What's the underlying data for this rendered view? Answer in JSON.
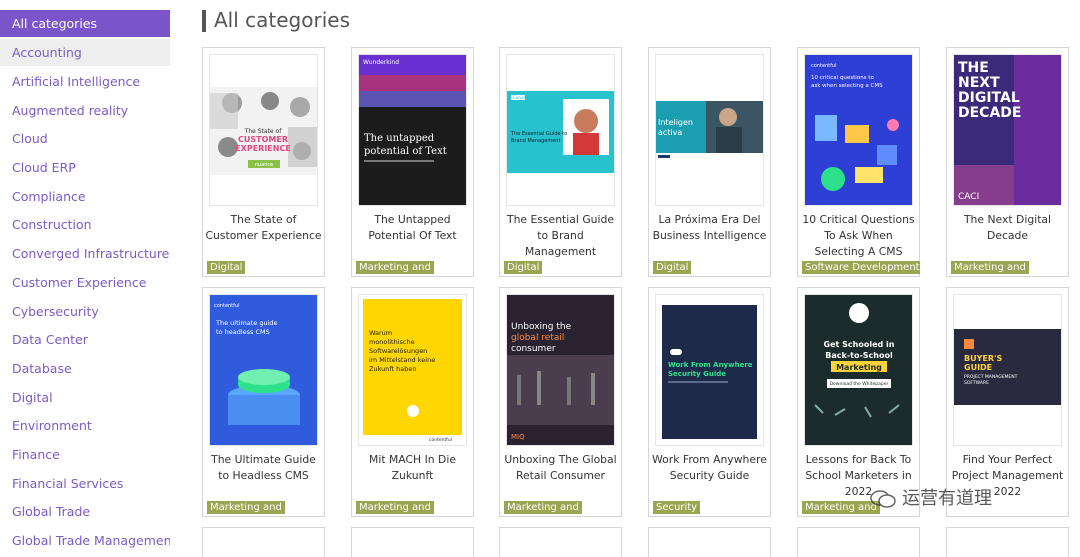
{
  "sidebar": {
    "items": [
      {
        "label": "All categories",
        "state": "active"
      },
      {
        "label": "Accounting",
        "state": "hover"
      },
      {
        "label": "Artificial Intelligence"
      },
      {
        "label": "Augmented reality"
      },
      {
        "label": "Cloud"
      },
      {
        "label": "Cloud ERP"
      },
      {
        "label": "Compliance"
      },
      {
        "label": "Construction"
      },
      {
        "label": "Converged Infrastructure"
      },
      {
        "label": "Customer Experience"
      },
      {
        "label": "Cybersecurity"
      },
      {
        "label": "Data Center"
      },
      {
        "label": "Database"
      },
      {
        "label": "Digital"
      },
      {
        "label": "Environment"
      },
      {
        "label": "Finance"
      },
      {
        "label": "Financial Services"
      },
      {
        "label": "Global Trade"
      },
      {
        "label": "Global Trade Management"
      }
    ]
  },
  "header": {
    "title": "All categories"
  },
  "cards": [
    {
      "title": "The State of Customer Experience",
      "tag": "Digital",
      "cover": {
        "lines": [
          "The State of",
          "CUSTOMER",
          "EXPERIENCE"
        ],
        "brand": "nuance",
        "bg": "#ffffff"
      }
    },
    {
      "title": "The Untapped Potential Of Text",
      "tag": "Marketing and",
      "cover": {
        "lines": [
          "The untapped",
          "potential of Text"
        ],
        "brand": "Wunderkind",
        "bg": "#1e1e1e"
      }
    },
    {
      "title": "The Essential Guide to Brand Management",
      "tag": "Digital",
      "cover": {
        "lines": [
          "The Essential Guide to",
          "Brand Management"
        ],
        "brand": "Canva",
        "bg": "#27c2cc"
      }
    },
    {
      "title": "La Próxima Era Del Business Intelligence",
      "tag": "Digital",
      "cover": {
        "lines": [
          "Inteligen",
          "activa"
        ],
        "brand": "",
        "bg": "#1a9fb1"
      }
    },
    {
      "title": "10 Critical Questions To Ask When Selecting A CMS",
      "tag": "Software Development",
      "cover": {
        "lines": [
          "10 critical questions to",
          "ask when selecting a CMS"
        ],
        "brand": "contentful",
        "bg": "#2e3fd6"
      }
    },
    {
      "title": "The Next Digital Decade",
      "tag": "Marketing and",
      "cover": {
        "lines": [
          "THE",
          "NEXT",
          "DIGITAL",
          "DECADE"
        ],
        "brand": "CACI",
        "bg": "#3b2a7a"
      }
    },
    {
      "title": "The Ultimate Guide to Headless CMS",
      "tag": "Marketing and",
      "cover": {
        "lines": [
          "The ultimate guide",
          "to headless CMS"
        ],
        "brand": "contentful",
        "bg": "#2f5bdc"
      }
    },
    {
      "title": "Mit MACH In Die Zukunft",
      "tag": "Marketing and",
      "cover": {
        "lines": [
          "Warum",
          "monolithische",
          "Softwarelösungen",
          "im Mittelstand keine",
          "Zukunft haben"
        ],
        "brand": "contentful",
        "bg": "#ffd600"
      }
    },
    {
      "title": "Unboxing The Global Retail Consumer",
      "tag": "Marketing and",
      "cover": {
        "lines": [
          "Unboxing the",
          "global retail",
          "consumer"
        ],
        "brand": "MIQ",
        "bg": "#2a2230"
      }
    },
    {
      "title": "Work From Anywhere Security Guide",
      "tag": "Security",
      "cover": {
        "lines": [
          "Work From Anywhere",
          "Security Guide"
        ],
        "brand": "",
        "bg": "#1d2a4a"
      }
    },
    {
      "title": "Lessons for Back To School Marketers in 2022",
      "tag": "Marketing and",
      "cover": {
        "lines": [
          "Get Schooled in",
          "Back-to-School",
          "Marketing"
        ],
        "button": "Download the Whitepaper",
        "brand": "",
        "bg": "#1c2b2b"
      }
    },
    {
      "title": "Find Your Perfect Project Management 2022",
      "tag": "",
      "cover": {
        "lines": [
          "BUYER'S",
          "GUIDE",
          "PROJECT MANAGEMENT",
          "SOFTWARE"
        ],
        "brand": "",
        "bg": "#2a2a3e"
      }
    }
  ],
  "watermark": {
    "text": "运营有道理"
  },
  "colors": {
    "accent": "#7a54c9",
    "link": "#7b5bc6",
    "tag": "#9aa652"
  }
}
